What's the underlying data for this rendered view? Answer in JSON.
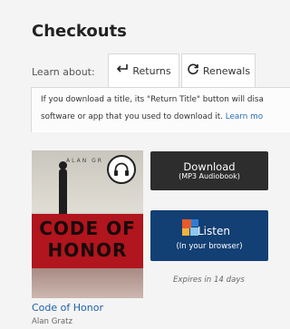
{
  "header": {
    "title": "Checkouts"
  },
  "learn": {
    "label": "Learn about:",
    "tabs": [
      {
        "label": "Returns",
        "icon": "return-arrow-icon"
      },
      {
        "label": "Renewals",
        "icon": "refresh-icon"
      }
    ]
  },
  "notice": {
    "line1": "If you download a title, its \"Return Title\" button will disa",
    "line2": "software or app that you used to download it. ",
    "link": "Learn mo"
  },
  "book": {
    "title": "Code of Honor",
    "author": "Alan Gratz",
    "cover": {
      "author_text": "ALAN GR",
      "title_lines": [
        "CODE OF",
        "HONOR"
      ]
    },
    "format_icon": "headphones-icon"
  },
  "actions": {
    "download": {
      "label": "Download",
      "sublabel": "(MP3 Audiobook)"
    },
    "listen": {
      "label": "Listen",
      "sublabel": "(In your browser)",
      "icon": "listen-app-icon"
    },
    "expires": "Expires in 14 days"
  },
  "colors": {
    "listen_button": "#123f74",
    "download_button": "#2d2d2d",
    "link": "#1f5fa8"
  }
}
